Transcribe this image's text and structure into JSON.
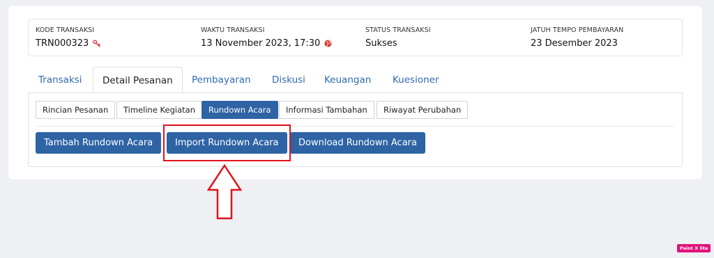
{
  "summary": {
    "kode": {
      "label": "KODE TRANSAKSI",
      "value": "TRN000323",
      "icon": "key-icon"
    },
    "waktu": {
      "label": "WAKTU TRANSAKSI",
      "value": "13 November 2023, 17:30",
      "icon": "globe-icon"
    },
    "status": {
      "label": "STATUS TRANSAKSI",
      "value": "Sukses"
    },
    "jatuh_tempo": {
      "label": "JATUH TEMPO PEMBAYARAN",
      "value": "23 Desember 2023"
    }
  },
  "tabs": [
    {
      "label": "Transaksi"
    },
    {
      "label": "Detail Pesanan",
      "active": true
    },
    {
      "label": "Pembayaran"
    },
    {
      "label": "Diskusi"
    },
    {
      "label": "Keuangan"
    },
    {
      "label": "Kuesioner"
    }
  ],
  "subtabs": [
    {
      "label": "Rincian Pesanan"
    },
    {
      "label": "Timeline Kegiatan"
    },
    {
      "label": "Rundown Acara",
      "active": true
    },
    {
      "label": "Informasi Tambahan"
    },
    {
      "label": "Riwayat Perubahan"
    }
  ],
  "actions": {
    "tambah": "Tambah Rundown Acara",
    "import": "Import Rundown Acara",
    "download": "Download Rundown Acara"
  },
  "badge": "Paint X lite",
  "colors": {
    "primary": "#2e63a4",
    "link": "#2e6bb0",
    "annotation": "#e0121c",
    "key_icon": "#e0393e",
    "badge": "#e2127a"
  }
}
